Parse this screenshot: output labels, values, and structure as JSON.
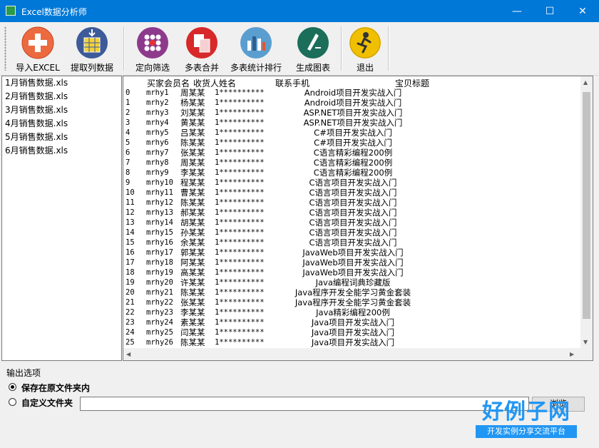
{
  "window": {
    "title": "Excel数据分析师",
    "minimize": "—",
    "maximize": "☐",
    "close": "✕"
  },
  "toolbar": [
    {
      "label": "导入EXCEL",
      "icon": "plus-icon",
      "color": "#e8542a"
    },
    {
      "label": "提取列数据",
      "icon": "extract-columns-icon",
      "color": "#3d5a99"
    },
    {
      "label": "定向筛选",
      "icon": "filter-dots-icon",
      "color": "#8d3a8c"
    },
    {
      "label": "多表合并",
      "icon": "merge-sheets-icon",
      "color": "#d7282a"
    },
    {
      "label": "多表统计排行",
      "icon": "bar-chart-icon",
      "color": "#4a8fc4"
    },
    {
      "label": "生成图表",
      "icon": "pen-chart-icon",
      "color": "#1a6e5a"
    },
    {
      "label": "退出",
      "icon": "exit-runner-icon",
      "color": "#f0b800"
    }
  ],
  "files": [
    "1月销售数据.xls",
    "2月销售数据.xls",
    "3月销售数据.xls",
    "4月销售数据.xls",
    "5月销售数据.xls",
    "6月销售数据.xls"
  ],
  "grid": {
    "headers": [
      "买家会员名",
      "收货人姓名",
      "联系手机",
      "宝贝标题"
    ],
    "rows": [
      [
        "0",
        "mrhy1",
        "周某某",
        "1**********",
        "Android项目开发实战入门"
      ],
      [
        "1",
        "mrhy2",
        "杨某某",
        "1**********",
        "Android项目开发实战入门"
      ],
      [
        "2",
        "mrhy3",
        "刘某某",
        "1**********",
        "ASP.NET项目开发实战入门"
      ],
      [
        "3",
        "mrhy4",
        "黄某某",
        "1**********",
        "ASP.NET项目开发实战入门"
      ],
      [
        "4",
        "mrhy5",
        "吕某某",
        "1**********",
        "C#项目开发实战入门"
      ],
      [
        "5",
        "mrhy6",
        "陈某某",
        "1**********",
        "C#项目开发实战入门"
      ],
      [
        "6",
        "mrhy7",
        "张某某",
        "1**********",
        "C语言精彩编程200例"
      ],
      [
        "7",
        "mrhy8",
        "周某某",
        "1**********",
        "C语言精彩编程200例"
      ],
      [
        "8",
        "mrhy9",
        "李某某",
        "1**********",
        "C语言精彩编程200例"
      ],
      [
        "9",
        "mrhy10",
        "程某某",
        "1**********",
        "C语言项目开发实战入门"
      ],
      [
        "10",
        "mrhy11",
        "曹某某",
        "1**********",
        "C语言项目开发实战入门"
      ],
      [
        "11",
        "mrhy12",
        "陈某某",
        "1**********",
        "C语言项目开发实战入门"
      ],
      [
        "12",
        "mrhy13",
        "郝某某",
        "1**********",
        "C语言项目开发实战入门"
      ],
      [
        "13",
        "mrhy14",
        "胡某某",
        "1**********",
        "C语言项目开发实战入门"
      ],
      [
        "14",
        "mrhy15",
        "孙某某",
        "1**********",
        "C语言项目开发实战入门"
      ],
      [
        "15",
        "mrhy16",
        "余某某",
        "1**********",
        "C语言项目开发实战入门"
      ],
      [
        "16",
        "mrhy17",
        "郭某某",
        "1**********",
        "JavaWeb项目开发实战入门"
      ],
      [
        "17",
        "mrhy18",
        "阿某某",
        "1**********",
        "JavaWeb项目开发实战入门"
      ],
      [
        "18",
        "mrhy19",
        "高某某",
        "1**********",
        "JavaWeb项目开发实战入门"
      ],
      [
        "19",
        "mrhy20",
        "许某某",
        "1**********",
        "Java编程词典珍藏版"
      ],
      [
        "20",
        "mrhy21",
        "陈某某",
        "1**********",
        "Java程序开发全能学习黄金套装"
      ],
      [
        "21",
        "mrhy22",
        "张某某",
        "1**********",
        "Java程序开发全能学习黄金套装"
      ],
      [
        "22",
        "mrhy23",
        "李某某",
        "1**********",
        "Java精彩编程200例"
      ],
      [
        "23",
        "mrhy24",
        "素某某",
        "1**********",
        "Java项目开发实战入门"
      ],
      [
        "24",
        "mrhy25",
        "闫某某",
        "1**********",
        "Java项目开发实战入门"
      ],
      [
        "25",
        "mrhy26",
        "陈某某",
        "1**********",
        "Java项目开发实战入门"
      ]
    ]
  },
  "output": {
    "group_label": "输出选项",
    "option_keep": "保存在原文件夹内",
    "option_custom": "自定义文件夹",
    "path_value": "",
    "browse_label": "浏览"
  },
  "watermark": {
    "brand": "好例子网",
    "tagline": "开发实例分享交流平台"
  }
}
